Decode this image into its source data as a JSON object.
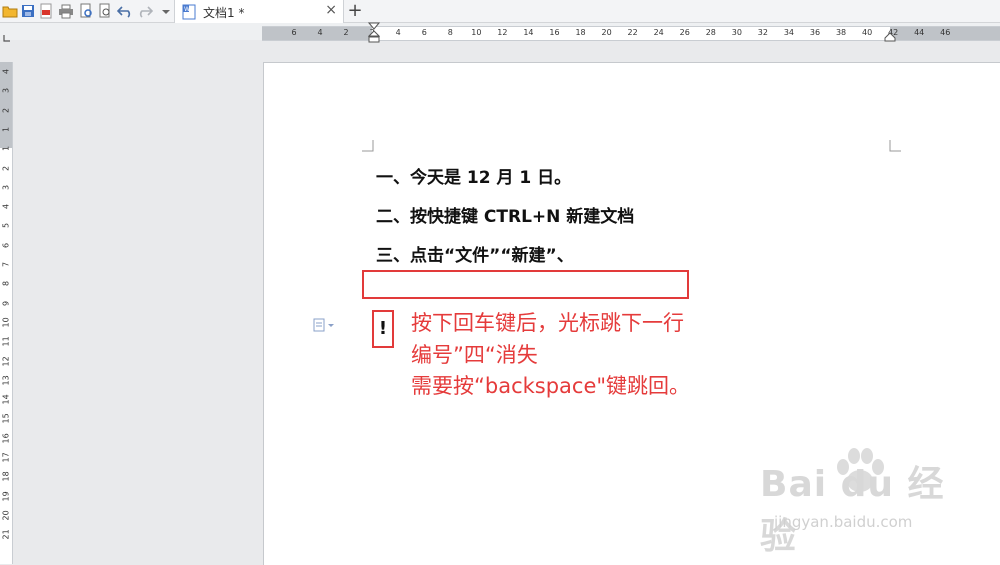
{
  "tab": {
    "title": "文档1 *",
    "close": "×",
    "new": "+"
  },
  "ruler": {
    "horizontal": [
      "6",
      "4",
      "2",
      "2",
      "4",
      "6",
      "8",
      "10",
      "12",
      "14",
      "16",
      "18",
      "20",
      "22",
      "24",
      "26",
      "28",
      "30",
      "32",
      "34",
      "36",
      "38",
      "40",
      "42",
      "44",
      "46"
    ],
    "vertical": [
      "4",
      "3",
      "2",
      "1",
      "1",
      "2",
      "3",
      "4",
      "5",
      "6",
      "7",
      "8",
      "9",
      "10",
      "11",
      "12",
      "13",
      "14",
      "15",
      "16",
      "17",
      "18",
      "19",
      "20",
      "21"
    ]
  },
  "document": {
    "lines": [
      "一、今天是 12 月 1 日。",
      "二、按快捷键 CTRL+N 新建文档",
      "三、点击“文件”“新建”、"
    ],
    "exclamation": "!",
    "annotation": [
      "按下回车键后，光标跳下一行",
      "编号”四“消失",
      "需要按“backspace\"键跳回。"
    ]
  },
  "watermark": {
    "brand": "Bai du 经验",
    "site": "jingyan.baidu.com"
  },
  "colors": {
    "annotation": "#e53b3b",
    "page": "#ffffff",
    "workspace": "#e9eaec"
  }
}
